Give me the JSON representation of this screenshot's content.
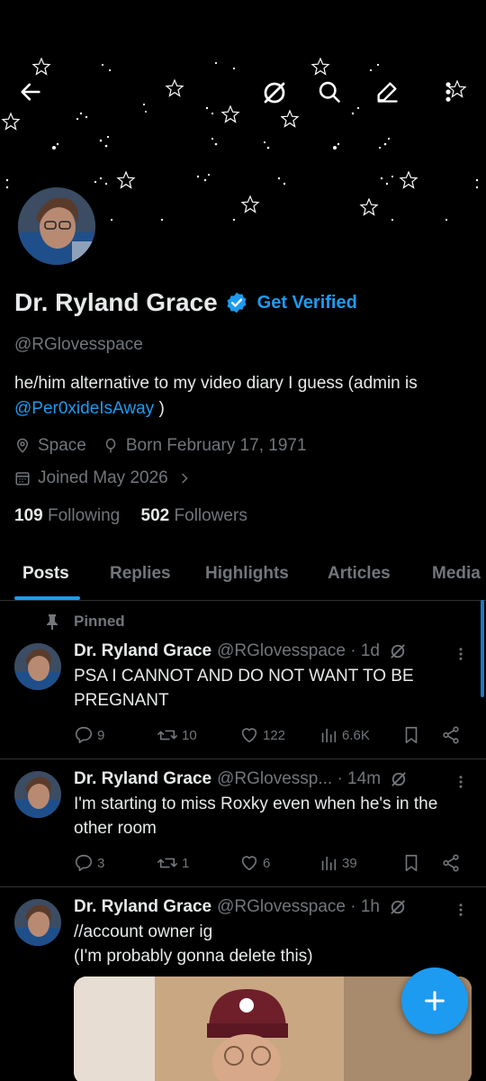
{
  "header": {
    "back_icon": "arrow-left-icon",
    "grok_icon": "grok-icon",
    "search_icon": "search-icon",
    "edit_icon": "pencil-icon",
    "more_icon": "more-vertical-icon"
  },
  "profile": {
    "name": "Dr. Ryland Grace",
    "get_verified": "Get Verified",
    "handle": "@RGlovesspace",
    "bio_text": "he/him  alternative to my video diary I guess  (admin is ",
    "bio_mention": "@Per0xideIsAway",
    "bio_end": " )",
    "location": "Space",
    "born": "Born February 17, 1971",
    "joined": "Joined May 2026",
    "following_count": "109",
    "following_label": "Following",
    "followers_count": "502",
    "followers_label": "Followers"
  },
  "tabs": [
    {
      "label": "Posts",
      "active": true
    },
    {
      "label": "Replies"
    },
    {
      "label": "Highlights"
    },
    {
      "label": "Articles"
    },
    {
      "label": "Media"
    }
  ],
  "pinned_label": "Pinned",
  "posts": [
    {
      "name": "Dr. Ryland Grace",
      "handle": "@RGlovesspace · 1d",
      "text": "PSA I CANNOT AND DO NOT WANT TO BE PREGNANT",
      "replies": "9",
      "reposts": "10",
      "likes": "122",
      "views": "6.6K"
    },
    {
      "name": "Dr. Ryland Grace",
      "handle": "@RGlovessp... · 14m",
      "text": "I'm starting to miss Roxky even when he's in the other room",
      "replies": "3",
      "reposts": "1",
      "likes": "6",
      "views": "39"
    },
    {
      "name": "Dr. Ryland Grace",
      "handle": "@RGlovesspace · 1h",
      "text": "//account owner ig\n(I'm probably gonna delete this)"
    }
  ],
  "colors": {
    "accent": "#1d9bf0",
    "text_primary": "#e7e9ea",
    "text_secondary": "#71767b",
    "background": "#000000"
  }
}
